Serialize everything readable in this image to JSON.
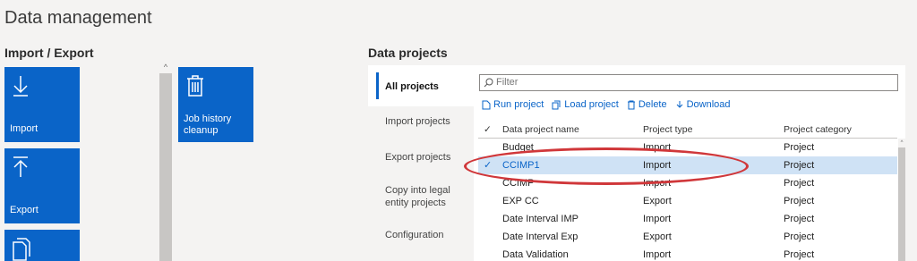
{
  "page_title": "Data management",
  "import_export": {
    "title": "Import / Export",
    "tiles": [
      {
        "label": "Import",
        "icon": "import-arrow-icon"
      },
      {
        "label": "Export",
        "icon": "export-arrow-icon"
      },
      {
        "label": "",
        "icon": "copy-icon"
      },
      {
        "label": "Job history cleanup",
        "icon": "trash-icon"
      }
    ]
  },
  "data_projects": {
    "title": "Data projects",
    "nav": [
      "All projects",
      "Import projects",
      "Export projects",
      "Copy into legal entity projects",
      "Configuration"
    ],
    "filter_placeholder": "Filter",
    "actions": [
      {
        "label": "Run project",
        "icon": "run-icon"
      },
      {
        "label": "Load project",
        "icon": "load-icon"
      },
      {
        "label": "Delete",
        "icon": "delete-icon"
      },
      {
        "label": "Download",
        "icon": "download-icon"
      }
    ],
    "columns": [
      "Data project name",
      "Project type",
      "Project category"
    ],
    "rows": [
      {
        "name": "Budget",
        "type": "Import",
        "category": "Project"
      },
      {
        "name": "CCIMP1",
        "type": "Import",
        "category": "Project",
        "selected": true
      },
      {
        "name": "CCIMP",
        "type": "Import",
        "category": "Project"
      },
      {
        "name": "EXP CC",
        "type": "Export",
        "category": "Project"
      },
      {
        "name": "Date Interval IMP",
        "type": "Import",
        "category": "Project"
      },
      {
        "name": "Date Interval Exp",
        "type": "Export",
        "category": "Project"
      },
      {
        "name": "Data Validation",
        "type": "Import",
        "category": "Project"
      }
    ]
  },
  "colors": {
    "accent": "#0a64c8",
    "selected_row": "#cfe2f5",
    "highlight": "#d0373a"
  }
}
